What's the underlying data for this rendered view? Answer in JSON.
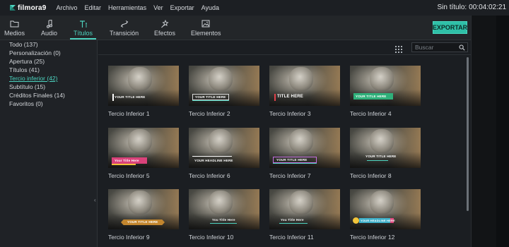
{
  "app": {
    "brand": "filmora9"
  },
  "menu": [
    {
      "label": "Archivo"
    },
    {
      "label": "Editar"
    },
    {
      "label": "Herramientas"
    },
    {
      "label": "Ver"
    },
    {
      "label": "Exportar"
    },
    {
      "label": "Ayuda"
    }
  ],
  "project": {
    "title": "Sin título:",
    "timecode": "00:04:02:21"
  },
  "tabs": [
    {
      "label": "Medios",
      "icon": "folder-icon"
    },
    {
      "label": "Audio",
      "icon": "music-note-icon"
    },
    {
      "label": "Títulos",
      "icon": "text-icon",
      "active": true
    },
    {
      "label": "Transición",
      "icon": "transition-icon"
    },
    {
      "label": "Efectos",
      "icon": "effects-icon"
    },
    {
      "label": "Elementos",
      "icon": "image-icon"
    }
  ],
  "export_label": "EXPORTAR",
  "categories": [
    {
      "label": "Todo (137)"
    },
    {
      "label": "Personalización (0)"
    },
    {
      "label": "Apertura (25)"
    },
    {
      "label": "Títulos (41)"
    },
    {
      "label": "Tercio inferior (42)",
      "active": true
    },
    {
      "label": "Subtítulo (15)"
    },
    {
      "label": "Créditos Finales (14)"
    },
    {
      "label": "Favoritos (0)"
    }
  ],
  "search": {
    "placeholder": "Buscar"
  },
  "accent_color": "#4dd3bf",
  "items": [
    {
      "label": "Tercio Inferior 1",
      "overlay": "YOUR TITLE HERE"
    },
    {
      "label": "Tercio Inferior 2",
      "overlay": "YOUR TITLE HERE"
    },
    {
      "label": "Tercio Inferior 3",
      "overlay": "TITLE HERE"
    },
    {
      "label": "Tercio Inferior 4",
      "overlay": "YOUR TITLE HERE"
    },
    {
      "label": "Tercio Inferior 5",
      "overlay": "Your Title Here"
    },
    {
      "label": "Tercio Inferior 6",
      "overlay": "YOUR HEADLINE HERE"
    },
    {
      "label": "Tercio Inferior 7",
      "overlay": "YOUR TITLE HERE"
    },
    {
      "label": "Tercio Inferior 8",
      "overlay": "YOUR TITLE HERE"
    },
    {
      "label": "Tercio Inferior 9",
      "overlay": "YOUR TITLE HERE"
    },
    {
      "label": "Tercio Inferior 10",
      "overlay": "You Title Here"
    },
    {
      "label": "Tercio Inferior 11",
      "overlay": "You Title Here"
    },
    {
      "label": "Tercio Inferior 12",
      "overlay": "YOUR HEADLINE HERE"
    }
  ]
}
